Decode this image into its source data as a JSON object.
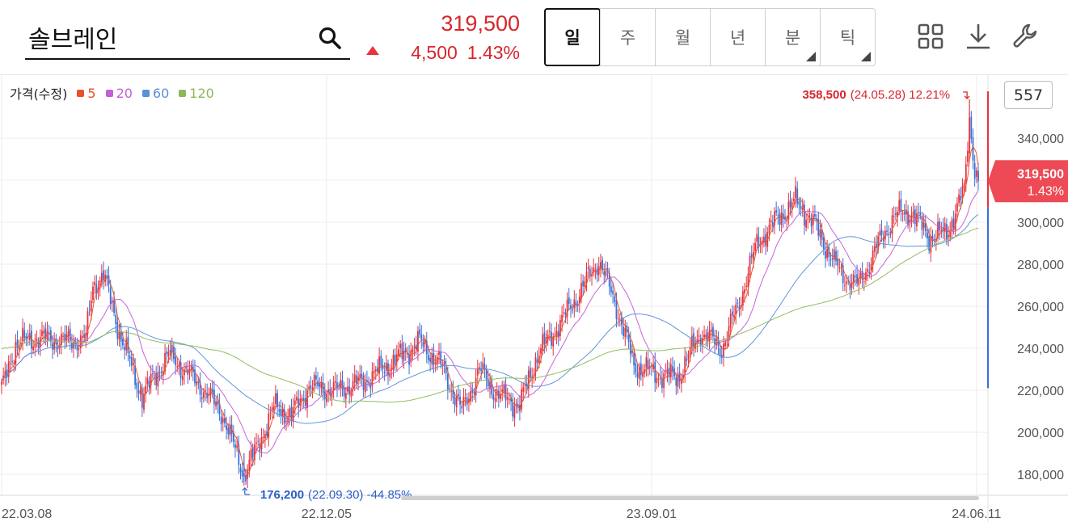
{
  "header": {
    "stock_name": "솔브레인",
    "price": "319,500",
    "change": "4,500",
    "change_pct": "1.43%"
  },
  "periods": [
    {
      "label": "일",
      "active": true,
      "corner": false
    },
    {
      "label": "주",
      "active": false,
      "corner": false
    },
    {
      "label": "월",
      "active": false,
      "corner": false
    },
    {
      "label": "년",
      "active": false,
      "corner": false
    },
    {
      "label": "분",
      "active": false,
      "corner": true
    },
    {
      "label": "틱",
      "active": false,
      "corner": true
    }
  ],
  "toolbar_icons": [
    "grid-icon",
    "download-icon",
    "wrench-icon"
  ],
  "legend": {
    "title": "가격(수정)",
    "items": [
      {
        "label": "5",
        "color": "#e8502a"
      },
      {
        "label": "20",
        "color": "#c35ed6"
      },
      {
        "label": "60",
        "color": "#5b8fd6"
      },
      {
        "label": "120",
        "color": "#8db85a"
      }
    ]
  },
  "count": "557",
  "colors": {
    "up": "#e8323c",
    "down": "#3a6fd8"
  },
  "chart_data": {
    "type": "candlestick",
    "ylim": [
      170000,
      370000
    ],
    "yticks": [
      "340,000",
      "320,000",
      "300,000",
      "280,000",
      "260,000",
      "240,000",
      "220,000",
      "200,000",
      "180,000"
    ],
    "ytick_values": [
      340000,
      320000,
      300000,
      280000,
      260000,
      240000,
      220000,
      200000,
      180000
    ],
    "xticks": [
      "22.03.08",
      "22.12.05",
      "23.09.01",
      "24.06.11"
    ],
    "xtick_index": [
      0,
      185,
      370,
      555
    ],
    "bar_count": 557,
    "last_price": {
      "label": "319,500",
      "pct": "1.43%",
      "value": 319500
    },
    "high_annotation": {
      "text": "358,500",
      "detail": "(24.05.28) 12.21%",
      "value": 358500
    },
    "low_annotation": {
      "text": "176,200",
      "detail": "(22.09.30) -44.85%",
      "value": 176200
    },
    "key_closes": [
      [
        0,
        220000
      ],
      [
        8,
        242000
      ],
      [
        20,
        245000
      ],
      [
        40,
        243000
      ],
      [
        48,
        245000
      ],
      [
        52,
        270000
      ],
      [
        58,
        275000
      ],
      [
        68,
        245000
      ],
      [
        80,
        217000
      ],
      [
        95,
        237000
      ],
      [
        110,
        225000
      ],
      [
        125,
        210000
      ],
      [
        138,
        180000
      ],
      [
        145,
        192000
      ],
      [
        155,
        212000
      ],
      [
        165,
        208000
      ],
      [
        175,
        222000
      ],
      [
        190,
        220000
      ],
      [
        205,
        224000
      ],
      [
        220,
        232000
      ],
      [
        238,
        243000
      ],
      [
        250,
        232000
      ],
      [
        262,
        210000
      ],
      [
        272,
        230000
      ],
      [
        282,
        218000
      ],
      [
        295,
        213000
      ],
      [
        305,
        237000
      ],
      [
        318,
        252000
      ],
      [
        330,
        268000
      ],
      [
        340,
        282000
      ],
      [
        350,
        260000
      ],
      [
        360,
        232000
      ],
      [
        372,
        228000
      ],
      [
        385,
        226000
      ],
      [
        398,
        248000
      ],
      [
        410,
        240000
      ],
      [
        420,
        262000
      ],
      [
        430,
        290000
      ],
      [
        442,
        302000
      ],
      [
        452,
        310000
      ],
      [
        462,
        300000
      ],
      [
        470,
        287000
      ],
      [
        478,
        275000
      ],
      [
        488,
        270000
      ],
      [
        498,
        288000
      ],
      [
        508,
        303000
      ],
      [
        518,
        305000
      ],
      [
        528,
        293000
      ],
      [
        538,
        295000
      ],
      [
        548,
        315000
      ],
      [
        551,
        350000
      ],
      [
        554,
        325000
      ],
      [
        556,
        319500
      ]
    ],
    "ma_series": [
      {
        "label": "5",
        "window": 5,
        "color": "#e8502a"
      },
      {
        "label": "20",
        "window": 20,
        "color": "#c35ed6"
      },
      {
        "label": "60",
        "window": 60,
        "color": "#5b8fd6"
      },
      {
        "label": "120",
        "window": 120,
        "color": "#8db85a"
      }
    ]
  }
}
